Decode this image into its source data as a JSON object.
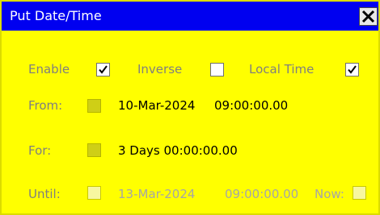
{
  "window": {
    "title": "Put Date/Time"
  },
  "options": {
    "enable": {
      "label": "Enable",
      "checked": true
    },
    "inverse": {
      "label": "Inverse",
      "checked": false
    },
    "local_time": {
      "label": "Local Time",
      "checked": true
    }
  },
  "from": {
    "label": "From:",
    "date": "10-Mar-2024",
    "time": "09:00:00.00"
  },
  "for": {
    "label": "For:",
    "duration": "3 Days 00:00:00.00"
  },
  "until": {
    "label": "Until:",
    "date": "13-Mar-2024",
    "time": "09:00:00.00",
    "now_label": "Now:"
  },
  "colors": {
    "background": "#ffff00",
    "titlebar": "#0000f0"
  },
  "icons": {
    "close": "close-icon",
    "check": "checkmark-icon"
  }
}
